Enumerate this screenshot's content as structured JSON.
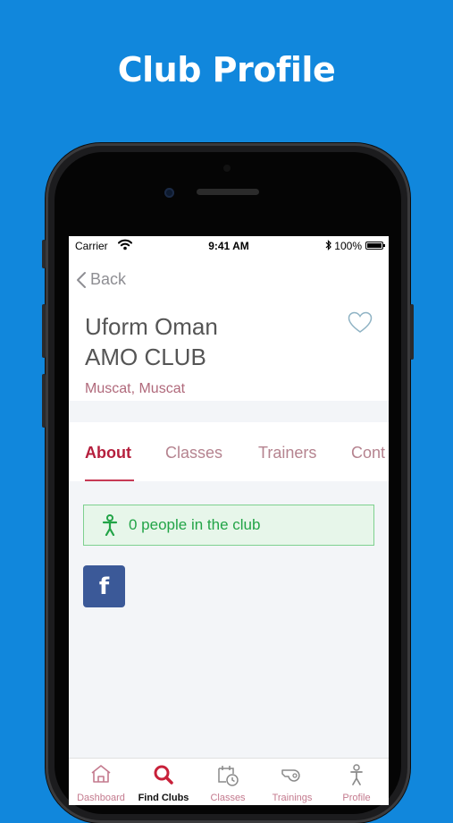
{
  "headline": "Club Profile",
  "status_bar": {
    "carrier": "Carrier",
    "time": "9:41 AM",
    "battery": "100%"
  },
  "header": {
    "back_label": "Back",
    "club_name_line1": "Uform Oman",
    "club_name_line2": "AMO CLUB",
    "location": "Muscat, Muscat"
  },
  "tabs": [
    {
      "label": "About",
      "active": true
    },
    {
      "label": "Classes",
      "active": false
    },
    {
      "label": "Trainers",
      "active": false
    },
    {
      "label": "Cont",
      "active": false
    }
  ],
  "members": {
    "text": "0 people in the club"
  },
  "social": {
    "facebook_glyph": "f"
  },
  "bottom_nav": [
    {
      "label": "Dashboard",
      "icon": "home-icon",
      "active": false
    },
    {
      "label": "Find Clubs",
      "icon": "search-icon",
      "active": true
    },
    {
      "label": "Classes",
      "icon": "calendar-clock-icon",
      "active": false
    },
    {
      "label": "Trainings",
      "icon": "whistle-icon",
      "active": false
    },
    {
      "label": "Profile",
      "icon": "person-icon",
      "active": false
    }
  ],
  "colors": {
    "background": "#1187dc",
    "accent": "#b51f3d",
    "inactive_tab": "#b5838f",
    "success_green": "#22a447",
    "facebook_blue": "#3b5998"
  }
}
